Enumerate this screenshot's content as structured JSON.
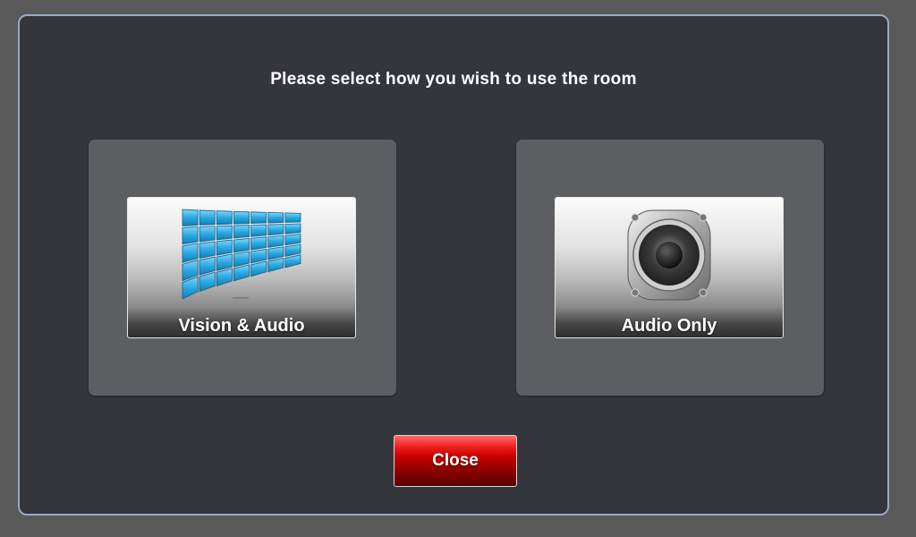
{
  "dialog": {
    "title": "Please select how you wish to use the room"
  },
  "options": [
    {
      "label": "Vision & Audio",
      "icon": "video-wall-icon"
    },
    {
      "label": "Audio Only",
      "icon": "speaker-icon"
    }
  ],
  "close_button": {
    "label": "Close"
  },
  "colors": {
    "background": "#595959",
    "dialog_bg": "#34363c",
    "dialog_border": "#9aa9c4",
    "panel_bg": "#5d5e62",
    "close_red": "#cc0000",
    "screen_blue": "#2aa9e0"
  }
}
